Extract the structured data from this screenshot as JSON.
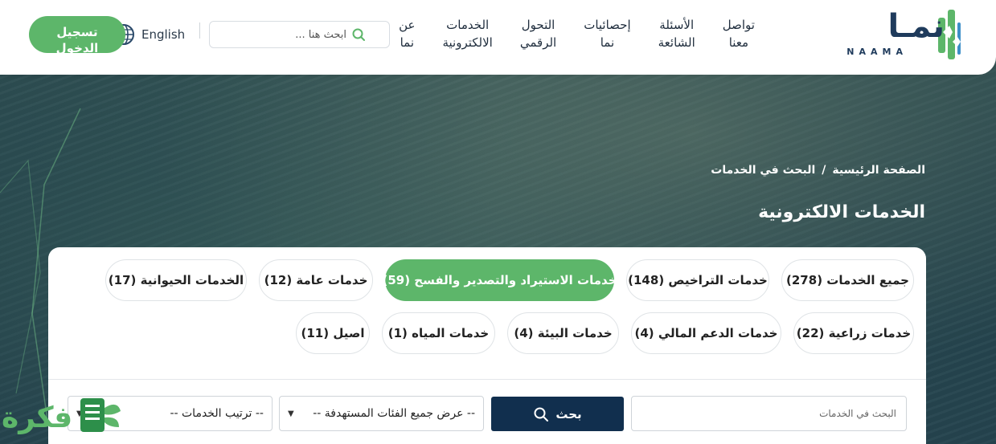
{
  "header": {
    "logo_text": "نمـا",
    "logo_sub": "NAAMA",
    "nav": [
      {
        "label": "عن\nنما"
      },
      {
        "label": "الخدمات\nالالكترونية"
      },
      {
        "label": "التحول\nالرقمي"
      },
      {
        "label": "إحصائيات\nنما"
      },
      {
        "label": "الأسئلة\nالشائعة"
      },
      {
        "label": "تواصل\nمعنا"
      }
    ],
    "search_placeholder": "ابحث هنا ...",
    "language_label": "English",
    "login_label": "تسجيل\nالدخول"
  },
  "breadcrumb": {
    "home": "الصفحة الرئيسية",
    "separator": "/",
    "current": "البحث في الخدمات"
  },
  "page_title": "الخدمات الالكترونية",
  "categories": [
    {
      "label": "جميع الخدمات (278)",
      "active": false
    },
    {
      "label": "خدمات التراخيص (148)",
      "active": false
    },
    {
      "label": "خدمات الاستيراد والتصدير والفسح (59)",
      "active": true
    },
    {
      "label": "خدمات عامة (12)",
      "active": false
    },
    {
      "label": "الخدمات الحيوانية (17)",
      "active": false
    },
    {
      "label": "خدمات زراعية (22)",
      "active": false
    },
    {
      "label": "خدمات الدعم المالي (4)",
      "active": false
    },
    {
      "label": "خدمات البيئة (4)",
      "active": false
    },
    {
      "label": "خدمات المياه (1)",
      "active": false
    },
    {
      "label": "اصيل (11)",
      "active": false
    }
  ],
  "filters": {
    "search_placeholder": "البحث في الخدمات",
    "search_button": "بحث",
    "audience_select": "-- عرض جميع الفئات المستهدفة --",
    "sort_select": "-- ترتيب الخدمات --"
  },
  "watermark": "فكرة",
  "colors": {
    "brand_green": "#5db66a",
    "navy": "#112f4e",
    "logo_navy": "#1f3b5c"
  }
}
